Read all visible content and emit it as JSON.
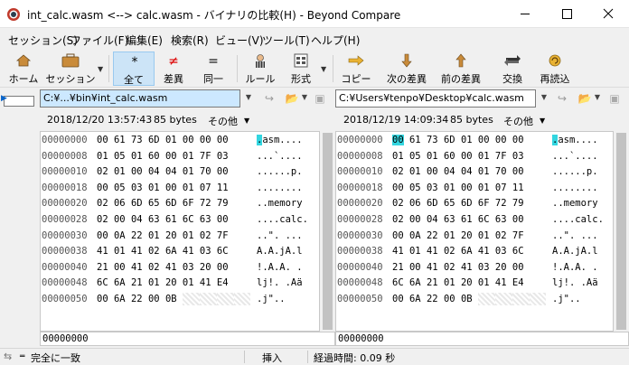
{
  "window": {
    "title": "int_calc.wasm <--> calc.wasm - バイナリの比較(H) - Beyond Compare"
  },
  "menu": [
    "セッション(S)",
    "ファイル(F)",
    "編集(E)",
    "検索(R)",
    "ビュー(V)",
    "ツール(T)",
    "ヘルプ(H)"
  ],
  "toolbar": {
    "home": "ホーム",
    "session": "セッション",
    "all": "全て",
    "diffs": "差異",
    "same": "同一",
    "rules": "ルール",
    "format": "形式",
    "copy": "コピー",
    "next_diff": "次の差異",
    "prev_diff": "前の差異",
    "swap": "交換",
    "reload": "再読込"
  },
  "left": {
    "path": "C:¥...¥bin¥int_calc.wasm",
    "date": "2018/12/20 13:57:43",
    "size": "85 bytes",
    "other": "その他",
    "footer_offset": "00000000"
  },
  "right": {
    "path": "C:¥Users¥tenpo¥Desktop¥calc.wasm",
    "date": "2018/12/19 14:09:34",
    "size": "85 bytes",
    "other": "その他",
    "footer_offset": "00000000"
  },
  "hex_rows": [
    {
      "offset": "00000000",
      "bytes": [
        "00",
        "61",
        "73",
        "6D",
        "01",
        "00",
        "00",
        "00"
      ],
      "ascii": ".asm...."
    },
    {
      "offset": "00000008",
      "bytes": [
        "01",
        "05",
        "01",
        "60",
        "00",
        "01",
        "7F",
        "03"
      ],
      "ascii": "...`...."
    },
    {
      "offset": "00000010",
      "bytes": [
        "02",
        "01",
        "00",
        "04",
        "04",
        "01",
        "70",
        "00"
      ],
      "ascii": "......p."
    },
    {
      "offset": "00000018",
      "bytes": [
        "00",
        "05",
        "03",
        "01",
        "00",
        "01",
        "07",
        "11"
      ],
      "ascii": "........"
    },
    {
      "offset": "00000020",
      "bytes": [
        "02",
        "06",
        "6D",
        "65",
        "6D",
        "6F",
        "72",
        "79"
      ],
      "ascii": "..memory"
    },
    {
      "offset": "00000028",
      "bytes": [
        "02",
        "00",
        "04",
        "63",
        "61",
        "6C",
        "63",
        "00"
      ],
      "ascii": "....calc."
    },
    {
      "offset": "00000030",
      "bytes": [
        "00",
        "0A",
        "22",
        "01",
        "20",
        "01",
        "02",
        "7F"
      ],
      "ascii": "..\". ..."
    },
    {
      "offset": "00000038",
      "bytes": [
        "41",
        "01",
        "41",
        "02",
        "6A",
        "41",
        "03",
        "6C"
      ],
      "ascii": "A.A.jA.l"
    },
    {
      "offset": "00000040",
      "bytes": [
        "21",
        "00",
        "41",
        "02",
        "41",
        "03",
        "20",
        "00"
      ],
      "ascii": "!.A.A. ."
    },
    {
      "offset": "00000048",
      "bytes": [
        "6C",
        "6A",
        "21",
        "01",
        "20",
        "01",
        "41",
        "E4"
      ],
      "ascii": "lj!. .Aä"
    },
    {
      "offset": "00000050",
      "bytes": [
        "00",
        "6A",
        "22",
        "00",
        "0B",
        "",
        "",
        "",
        ""
      ],
      "ascii": ".j\".."
    }
  ],
  "status": {
    "match": "完全に一致",
    "mode": "挿入",
    "elapsed": "経過時間: 0.09 秒"
  },
  "colors": {
    "highlight": "#33d6e0",
    "selection": "#cce8ff"
  }
}
